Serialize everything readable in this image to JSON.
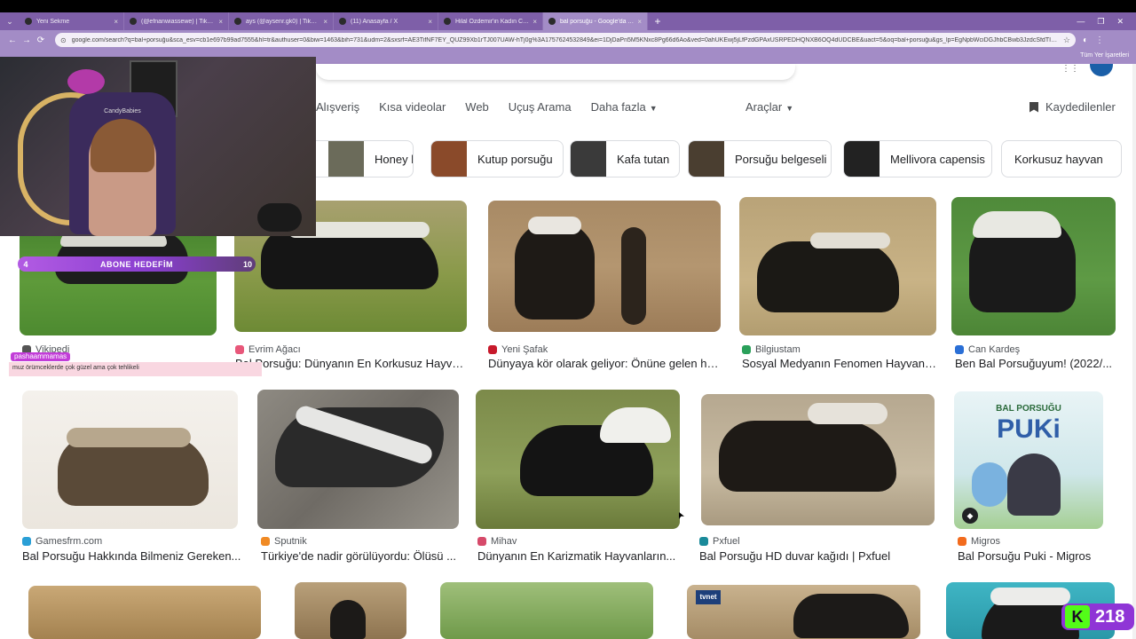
{
  "browser": {
    "tabs": [
      {
        "label": "Yeni Sekme",
        "active": false
      },
      {
        "label": "(@efnanwiassewe) | TikTok",
        "active": false
      },
      {
        "label": "ays (@aysenr.gk0) | TikTok",
        "active": false
      },
      {
        "label": "(11) Anasayfa / X",
        "active": false
      },
      {
        "label": "Hilal Özdemir'in Kadın Cinayeti",
        "active": false
      },
      {
        "label": "bal porsuğu - Google'da Ara",
        "active": true
      }
    ],
    "new_tab": "+",
    "url": "google.com/search?q=bal+porsuğu&sca_esv=cb1e697b99ad7555&hl=tr&authuser=0&biw=1463&bih=731&udm=2&sxsrf=AE3TifNF7EY_QUZ99Xb1rTJ007UAW-hTj0g%3A1757624532849&ei=1DjDaPn5M5KNxc8Pg66d6Ao&ved=0ahUKEwj5jLfPzdGPAxUSRPEDHQNXB6OQ4dUDCBE&uact=5&oq=bal+porsuğu&gs_lp=EgNpbWciDGJhbCBwb3JzdcSfdTIEEAAY",
    "bookmarks_all": "Tüm Yer İşaretleri"
  },
  "google": {
    "nav": [
      {
        "label": "Alışveriş",
        "has_caret": false
      },
      {
        "label": "Kısa videolar",
        "has_caret": false
      },
      {
        "label": "Web",
        "has_caret": false
      },
      {
        "label": "Uçuş Arama",
        "has_caret": false
      },
      {
        "label": "Daha fazla",
        "has_caret": true
      }
    ],
    "tools": "Araçlar",
    "saved": "Kaydedilenler",
    "chips": [
      {
        "label": "Honey badger",
        "thumb": "#6b6b5a"
      },
      {
        "label": "Kutup porsuğu",
        "thumb": "#8a4a2a"
      },
      {
        "label": "Kafa tutan",
        "thumb": "#3a3a3a"
      },
      {
        "label": "Porsuğu belgeseli",
        "thumb": "#4a3e30"
      },
      {
        "label": "Mellivora capensis",
        "thumb": "#222222"
      },
      {
        "label": "Korkusuz hayvan",
        "thumb": null
      }
    ],
    "row1": [
      {
        "source": "Vikipedi",
        "title": "",
        "favicon": "#555555"
      },
      {
        "source": "Evrim Ağacı",
        "title": "Bal Porsuğu: Dünyanın En Korkusuz Hayva...",
        "favicon": "#e8577a"
      },
      {
        "source": "Yeni Şafak",
        "title": "Dünyaya kör olarak geliyor: Önüne gelen he...",
        "favicon": "#c7192b"
      },
      {
        "source": "Bilgiustam",
        "title": "Sosyal Medyanın Fenomen Hayvanı...",
        "favicon": "#2aa05a"
      },
      {
        "source": "Can Kardeş",
        "title": "Ben Bal Porsuğuyum! (2022/...",
        "favicon": "#2a6fd6"
      }
    ],
    "row2": [
      {
        "source": "Gamesfrm.com",
        "title": "Bal Porsuğu Hakkında Bilmeniz Gereken...",
        "favicon": "#2a9fd6"
      },
      {
        "source": "Sputnik",
        "title": "Türkiye'de nadir görülüyordu: Ölüsü ...",
        "favicon": "#f08a24"
      },
      {
        "source": "Mihav",
        "title": "Dünyanın En Karizmatik Hayvanların...",
        "favicon": "#d64a6a"
      },
      {
        "source": "Pxfuel",
        "title": "Bal Porsuğu HD duvar kağıdı | Pxfuel",
        "favicon": "#1a8a9a"
      },
      {
        "source": "Migros",
        "title": "Bal Porsuğu Puki - Migros",
        "favicon": "#f26b1d"
      }
    ],
    "book_cover": {
      "top": "BAL PORSUĞU",
      "title": "PUKi"
    },
    "tvnet_label": "tvnet"
  },
  "overlay": {
    "webcam_label": "CandyBabies",
    "bar_left": "4",
    "bar_text": "ABONE HEDEFİM",
    "bar_right": "10",
    "chat_name": "pashaammamas",
    "chat_text": "muz örümceklerde çok güzel ama çok tehlikeli",
    "viewer_count": "218",
    "kick_letter": "K"
  }
}
